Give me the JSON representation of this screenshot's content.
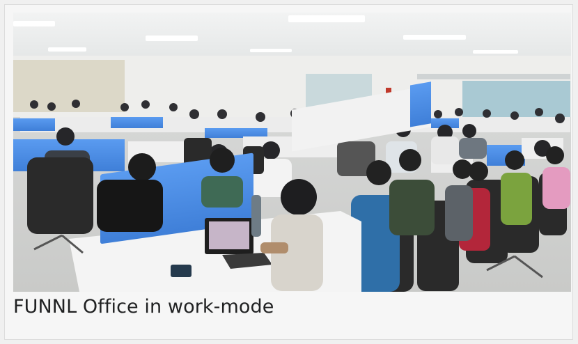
{
  "figure": {
    "caption": "FUNNL Office in work-mode"
  },
  "colors": {
    "card_background": "#f6f6f6",
    "caption_text": "#202122",
    "partition_blue": "#4f8ee6",
    "desk_white": "#f4f4f4",
    "chair_black": "#2a2a2a"
  }
}
